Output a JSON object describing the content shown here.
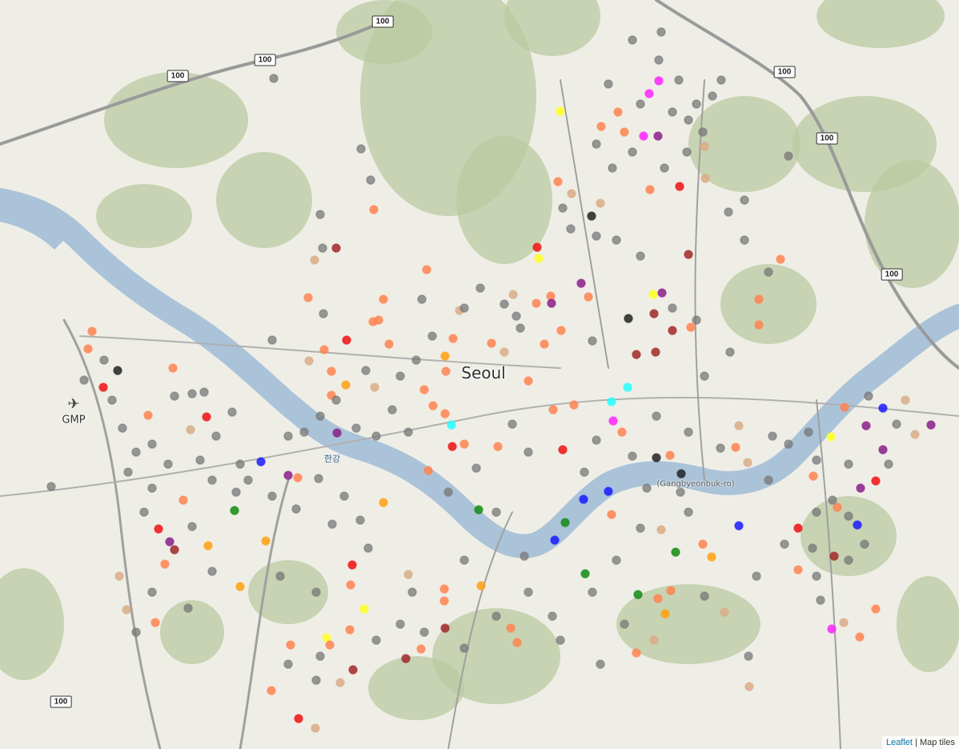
{
  "map": {
    "city_label": "Seoul",
    "airport_label": "GMP",
    "river_label": "한강",
    "road_label": "(Gangbyeonbuk-ro)",
    "route_shields": [
      "100",
      "100",
      "100",
      "100",
      "100",
      "100",
      "100"
    ],
    "attribution": {
      "leaflet_link": "Leaflet",
      "separator": " | ",
      "tiles_text": "Map tiles"
    },
    "marker_colors": {
      "gray": "#777777",
      "orange": "#ff8250",
      "red": "#ee1111",
      "darkred": "#a02828",
      "purple": "#8a1e8a",
      "magenta": "#ff22ff",
      "yellow": "#ffff22",
      "blue": "#1a1aff",
      "green": "#138a13",
      "cyan": "#22ffff",
      "black": "#222222",
      "tan": "#d9ab86",
      "amber": "#ffa010"
    }
  }
}
